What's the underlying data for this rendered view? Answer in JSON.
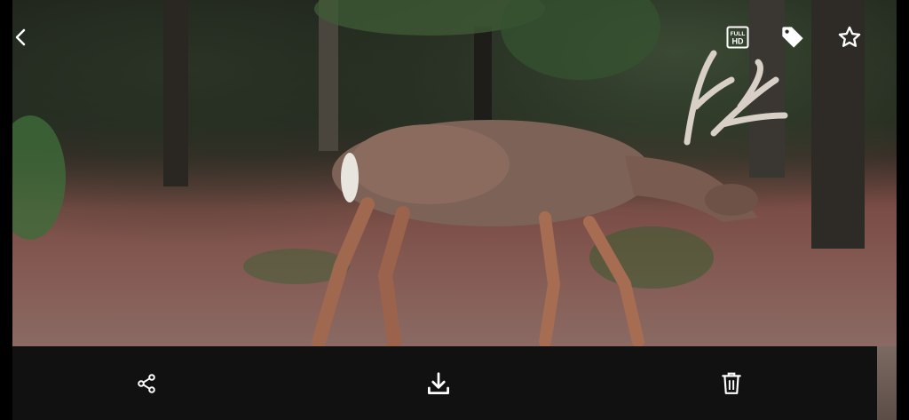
{
  "viewer": {
    "photo_subject": "deer",
    "top_bar": {
      "back_icon": "chevron-left-icon",
      "hd_icon": "full-hd-icon",
      "hd_text_top": "FULL",
      "hd_text_bottom": "HD",
      "tag_icon": "tag-icon",
      "favorite_icon": "star-outline-icon"
    },
    "bottom_bar": {
      "share_icon": "share-icon",
      "download_icon": "download-icon",
      "delete_icon": "trash-icon"
    }
  },
  "colors": {
    "icon": "#ffffff",
    "bottom_bar": "#111111"
  }
}
